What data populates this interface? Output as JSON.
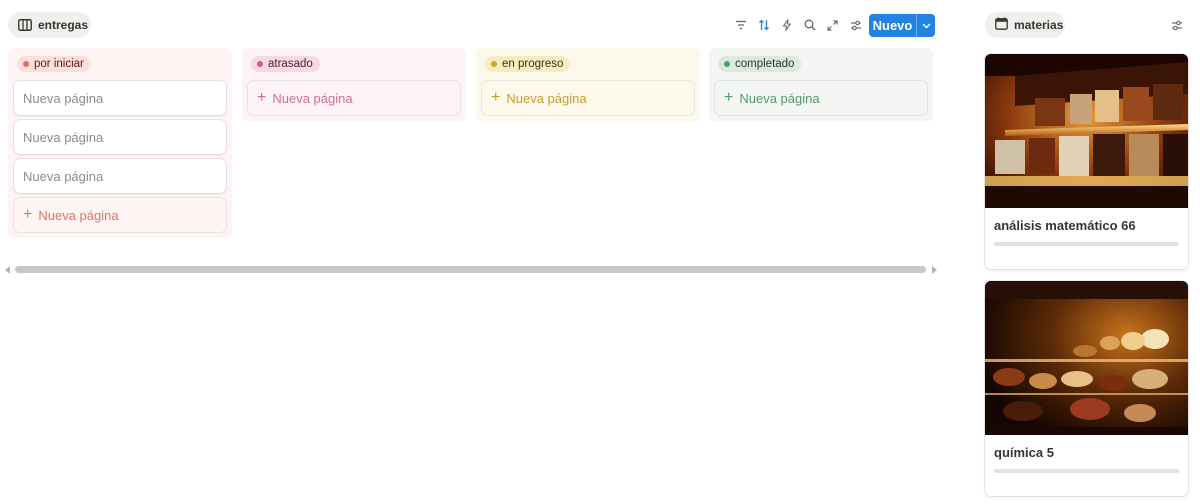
{
  "board_view": {
    "tab_label": "entregas",
    "tab_icon": "board-icon"
  },
  "toolbar": {
    "icons": [
      "filter-icon",
      "sort-icon",
      "automation-icon",
      "search-icon",
      "expand-icon",
      "settings-icon"
    ],
    "new_label": "Nuevo",
    "new_dropdown_icon": "chevron-down-icon",
    "new_color": "#2383e2"
  },
  "columns": [
    {
      "status": "por iniciar",
      "bg": "#fdf5f4",
      "pill_bg": "#fadfdb",
      "dot": "#e16b5d",
      "text_color": "#5d1715",
      "add_color": "#d8766b",
      "cards": [
        "Nueva página",
        "Nueva página",
        "Nueva página"
      ],
      "add_label": "Nueva página"
    },
    {
      "status": "atrasado",
      "bg": "#fcf3f6",
      "pill_bg": "#f6d9e4",
      "dot": "#d05a8c",
      "text_color": "#4c2337",
      "add_color": "#d26d93",
      "cards": [],
      "add_label": "Nueva página"
    },
    {
      "status": "en progreso",
      "bg": "#fcf9ec",
      "pill_bg": "#f7ecc0",
      "dot": "#d7a323",
      "text_color": "#402c1b",
      "add_color": "#c89f2c",
      "cards": [],
      "add_label": "Nueva página"
    },
    {
      "status": "completado",
      "bg": "#f4f6f4",
      "pill_bg": "#dde9e0",
      "dot": "#4aa06a",
      "text_color": "#1c3829",
      "add_color": "#4f9a6b",
      "cards": [],
      "add_label": "Nueva página"
    }
  ],
  "gallery_view": {
    "tab_label": "materias",
    "tab_icon": "calendar-icon",
    "settings_icon": "settings-icon",
    "cards": [
      {
        "title": "análisis matemático 66",
        "cover": "photo-record-shop",
        "progress": 0
      },
      {
        "title": "química 5",
        "cover": "photo-bakery-display",
        "progress": 0
      }
    ]
  }
}
